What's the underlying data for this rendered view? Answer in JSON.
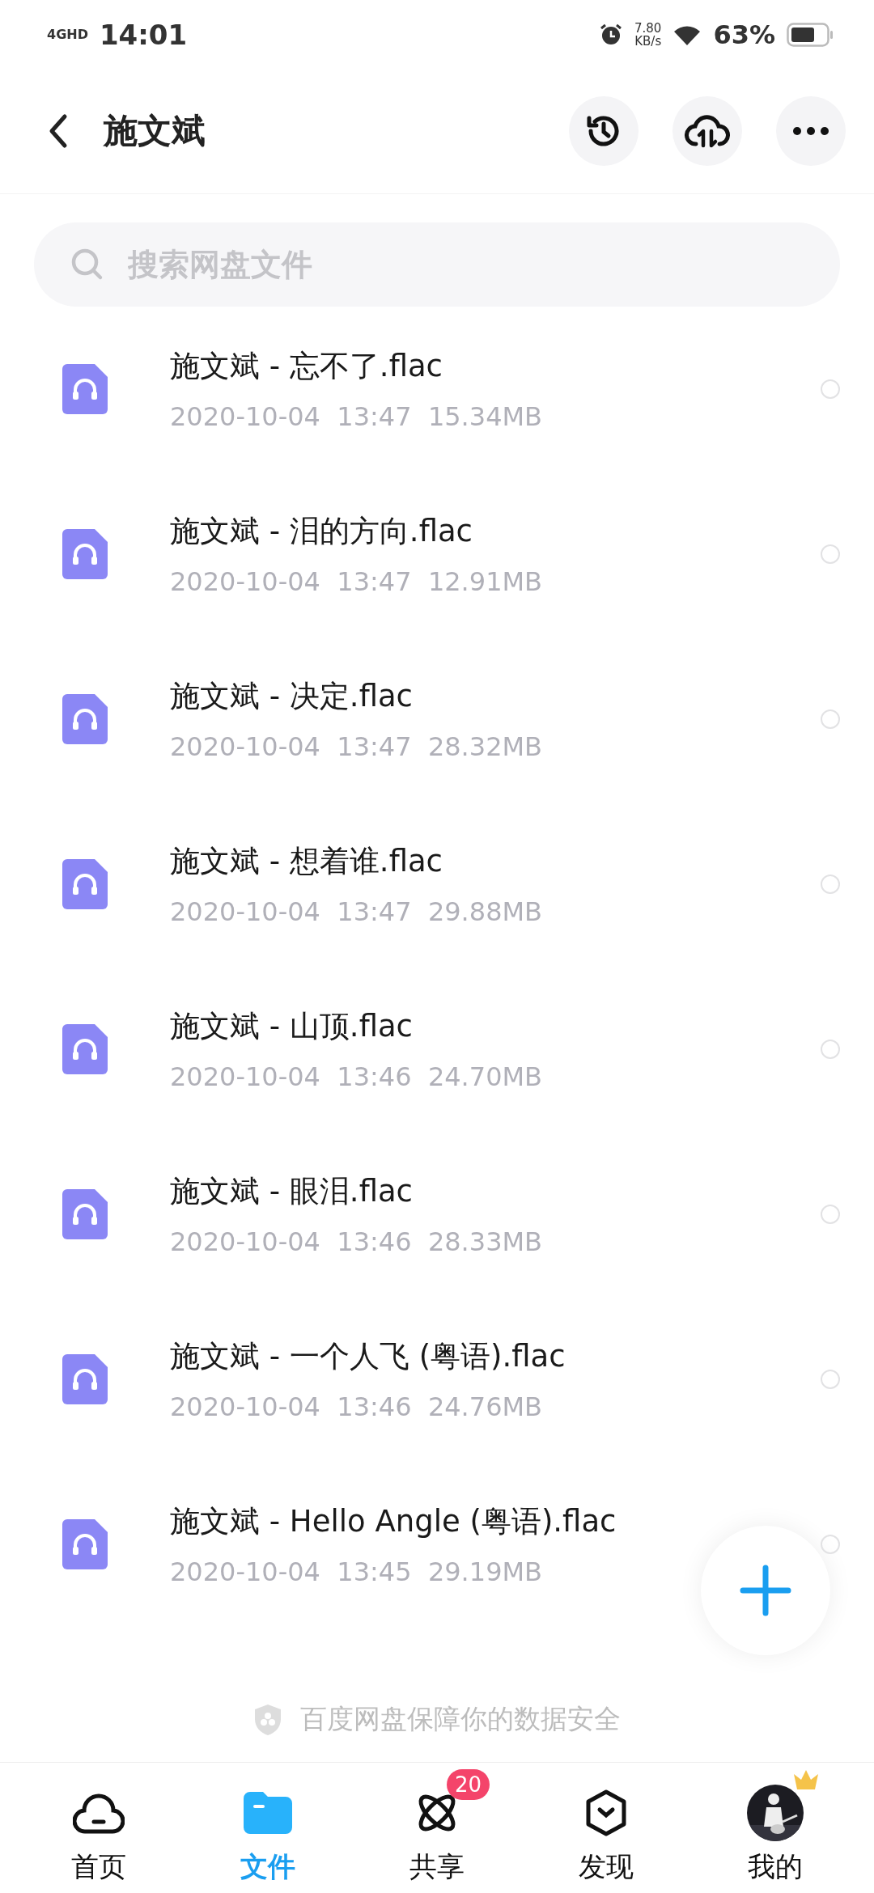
{
  "status_bar": {
    "network": "4GHD",
    "time": "14:01",
    "speed": "7.80",
    "speed_unit": "KB/s",
    "battery": "63%"
  },
  "header": {
    "title": "施文斌"
  },
  "search": {
    "placeholder": "搜索网盘文件"
  },
  "files": [
    {
      "name": "施文斌 - 忘不了.flac",
      "meta": "2020-10-04  13:47  15.34MB",
      "selected": false
    },
    {
      "name": "施文斌 - 泪的方向.flac",
      "meta": "2020-10-04  13:47  12.91MB",
      "selected": false
    },
    {
      "name": "施文斌 - 决定.flac",
      "meta": "2020-10-04  13:47  28.32MB",
      "selected": false
    },
    {
      "name": "施文斌 - 想着谁.flac",
      "meta": "2020-10-04  13:47  29.88MB",
      "selected": false
    },
    {
      "name": "施文斌 - 山顶.flac",
      "meta": "2020-10-04  13:46  24.70MB",
      "selected": false
    },
    {
      "name": "施文斌 - 眼泪.flac",
      "meta": "2020-10-04  13:46  28.33MB",
      "selected": false
    },
    {
      "name": "施文斌 - 一个人飞 (粤语).flac",
      "meta": "2020-10-04  13:46  24.76MB",
      "selected": false
    },
    {
      "name": "施文斌 - Hello Angle (粤语).flac",
      "meta": "2020-10-04  13:45  29.19MB",
      "selected": false
    }
  ],
  "footer": "百度网盘保障你的数据安全",
  "tabs": [
    {
      "kind": "home",
      "label": "首页",
      "selected": false
    },
    {
      "kind": "files",
      "label": "文件",
      "selected": true
    },
    {
      "kind": "share",
      "label": "共享",
      "selected": false,
      "badge": "20"
    },
    {
      "kind": "discover",
      "label": "发现",
      "selected": false
    },
    {
      "kind": "me",
      "label": "我的",
      "selected": false
    }
  ]
}
